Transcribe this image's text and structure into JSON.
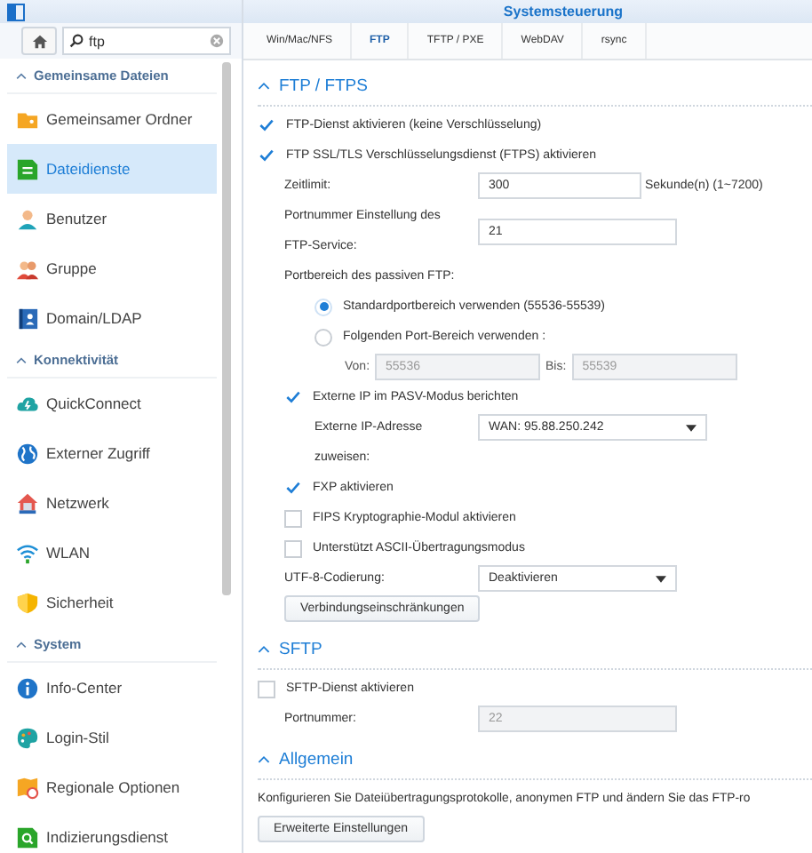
{
  "window": {
    "title": "Systemsteuerung"
  },
  "sidebar": {
    "search": {
      "value": "ftp"
    },
    "sections": [
      {
        "title": "Gemeinsame Dateien",
        "expanded": true,
        "items": [
          {
            "label": "Gemeinsamer Ordner",
            "selected": false
          },
          {
            "label": "Dateidienste",
            "selected": true
          },
          {
            "label": "Benutzer",
            "selected": false
          },
          {
            "label": "Gruppe",
            "selected": false
          },
          {
            "label": "Domain/LDAP",
            "selected": false
          }
        ]
      },
      {
        "title": "Konnektivität",
        "expanded": true,
        "items": [
          {
            "label": "QuickConnect",
            "selected": false
          },
          {
            "label": "Externer Zugriff",
            "selected": false
          },
          {
            "label": "Netzwerk",
            "selected": false
          },
          {
            "label": "WLAN",
            "selected": false
          },
          {
            "label": "Sicherheit",
            "selected": false
          }
        ]
      },
      {
        "title": "System",
        "expanded": true,
        "items": [
          {
            "label": "Info-Center",
            "selected": false
          },
          {
            "label": "Login-Stil",
            "selected": false
          },
          {
            "label": "Regionale Optionen",
            "selected": false
          },
          {
            "label": "Indizierungsdienst",
            "selected": false
          }
        ]
      }
    ]
  },
  "tabs": [
    {
      "label": "Win/Mac/NFS",
      "selected": false
    },
    {
      "label": "FTP",
      "selected": true
    },
    {
      "label": "TFTP / PXE",
      "selected": false
    },
    {
      "label": "WebDAV",
      "selected": false
    },
    {
      "label": "rsync",
      "selected": false
    }
  ],
  "sections": [
    {
      "title": "FTP / FTPS",
      "expanded": true,
      "rows": [
        {
          "kind": "checkbox",
          "label": "FTP-Dienst aktivieren (keine Verschlüsselung)",
          "checked": true
        },
        {
          "kind": "checkbox",
          "label": "FTP SSL/TLS Verschlüsselungsdienst (FTPS) aktivieren",
          "checked": true,
          "children": [
            {
              "kind": "field",
              "label": "Zeitlimit:",
              "value": "300",
              "suffix": "Sekunde(n) (1~7200)",
              "disabled": false
            },
            {
              "kind": "field",
              "label": "Portnummer Einstellung des FTP-Service:",
              "value": "21",
              "disabled": false
            },
            {
              "kind": "text",
              "label": "Portbereich des passiven FTP:",
              "children": [
                {
                  "kind": "radio",
                  "label": "Standardportbereich verwenden (55536-55539)",
                  "selected": true
                },
                {
                  "kind": "radio",
                  "label": "Folgenden Port-Bereich verwenden :",
                  "selected": false,
                  "children": [
                    {
                      "kind": "range",
                      "from_label": "Von:",
                      "from_value": "55536",
                      "to_label": "Bis:",
                      "to_value": "55539",
                      "disabled": true
                    }
                  ]
                }
              ]
            },
            {
              "kind": "checkbox",
              "label": "Externe IP im PASV-Modus berichten",
              "checked": true,
              "children": [
                {
                  "kind": "select",
                  "label": "Externe IP-Adresse zuweisen:",
                  "value": "WAN: 95.88.250.242"
                }
              ]
            },
            {
              "kind": "checkbox",
              "label": "FXP aktivieren",
              "checked": true
            },
            {
              "kind": "checkbox",
              "label": "FIPS Kryptographie-Modul aktivieren",
              "checked": false
            },
            {
              "kind": "checkbox",
              "label": "Unterstützt ASCII-Übertragungsmodus",
              "checked": false
            },
            {
              "kind": "select",
              "label": "UTF-8-Codierung:",
              "value": "Deaktivieren"
            },
            {
              "kind": "button",
              "label": "Verbindungseinschränkungen"
            }
          ]
        }
      ]
    },
    {
      "title": "SFTP",
      "expanded": true,
      "rows": [
        {
          "kind": "checkbox",
          "label": "SFTP-Dienst aktivieren",
          "checked": false,
          "children": [
            {
              "kind": "field",
              "label": "Portnummer:",
              "value": "22",
              "disabled": true
            }
          ]
        }
      ]
    },
    {
      "title": "Allgemein",
      "expanded": true,
      "rows": [
        {
          "kind": "paragraph",
          "label": "Konfigurieren Sie Dateiübertragungsprotokolle, anonymen FTP und ändern Sie das FTP-ro"
        },
        {
          "kind": "button",
          "label": "Erweiterte Einstellungen"
        }
      ]
    }
  ]
}
